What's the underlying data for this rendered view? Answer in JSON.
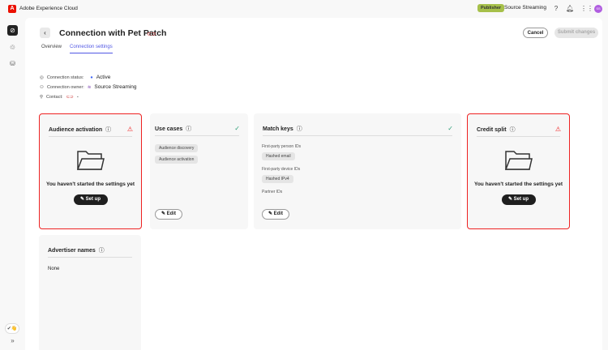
{
  "header": {
    "app_name": "Adobe Experience Cloud",
    "role_badge": "Publisher",
    "org_name": "Source Streaming",
    "avatar": "SS"
  },
  "page": {
    "title": "Connection with Pet Patch",
    "tabs": [
      "Overview",
      "Connection settings"
    ],
    "cancel": "Cancel",
    "submit": "Submit changes"
  },
  "info": {
    "status_label": "Connection status:",
    "status_value": "Active",
    "owner_label": "Connection owner:",
    "owner_value": "Source Streaming",
    "contact_label": "Contact:",
    "contact_value": "-"
  },
  "cards": {
    "audience": {
      "title": "Audience activation",
      "message": "You haven't started the settings yet",
      "button": "Set up"
    },
    "use_cases": {
      "title": "Use cases",
      "chips": [
        "Audience discovery",
        "Audience activation"
      ],
      "button": "Edit"
    },
    "match_keys": {
      "title": "Match keys",
      "groups": [
        {
          "label": "First-party person IDs",
          "chip": "Hashed email"
        },
        {
          "label": "First-party device IDs",
          "chip": "Hashed IPv4"
        },
        {
          "label": "Partner IDs"
        }
      ],
      "button": "Edit"
    },
    "credit": {
      "title": "Credit split",
      "message": "You haven't started the settings yet",
      "button": "Set up"
    },
    "advertiser": {
      "title": "Advertiser names",
      "value": "None"
    }
  },
  "colors": {
    "accent": "#5258e4",
    "error": "#e22222",
    "success": "#2d9d78",
    "publisher": "#a6c04a"
  }
}
